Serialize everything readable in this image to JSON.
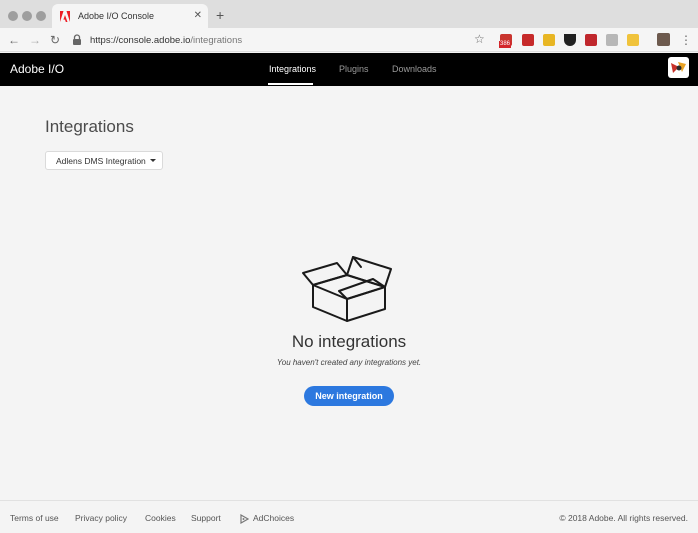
{
  "browser": {
    "tab_title": "Adobe I/O Console",
    "tab_close": "✕",
    "new_tab": "+",
    "back": "←",
    "forward": "→",
    "reload": "↻",
    "url_base": "https://console.adobe.io",
    "url_path": "/integrations",
    "star": "☆",
    "extension_badge": "386",
    "menu": "⋮"
  },
  "header": {
    "brand": "Adobe I/O",
    "nav": [
      {
        "label": "Integrations",
        "active": true
      },
      {
        "label": "Plugins",
        "active": false
      },
      {
        "label": "Downloads",
        "active": false
      }
    ]
  },
  "main": {
    "title": "Integrations",
    "org_dropdown": "Adlens DMS Integration",
    "empty_state": {
      "title": "No integrations",
      "subtitle": "You haven't created any integrations yet.",
      "button": "New integration"
    }
  },
  "footer": {
    "links": [
      "Terms of use",
      "Privacy policy",
      "Cookies",
      "Support",
      "AdChoices"
    ],
    "copyright": "© 2018 Adobe. All rights reserved."
  },
  "colors": {
    "header_bg": "#000000",
    "accent_blue": "#2c78df",
    "adobe_red": "#ed1c24",
    "page_bg": "#f4f4f4"
  },
  "icons": [
    "adobe-logo-icon",
    "lock-icon",
    "star-icon",
    "open-box-icon",
    "adchoices-icon",
    "chevron-down-icon"
  ]
}
